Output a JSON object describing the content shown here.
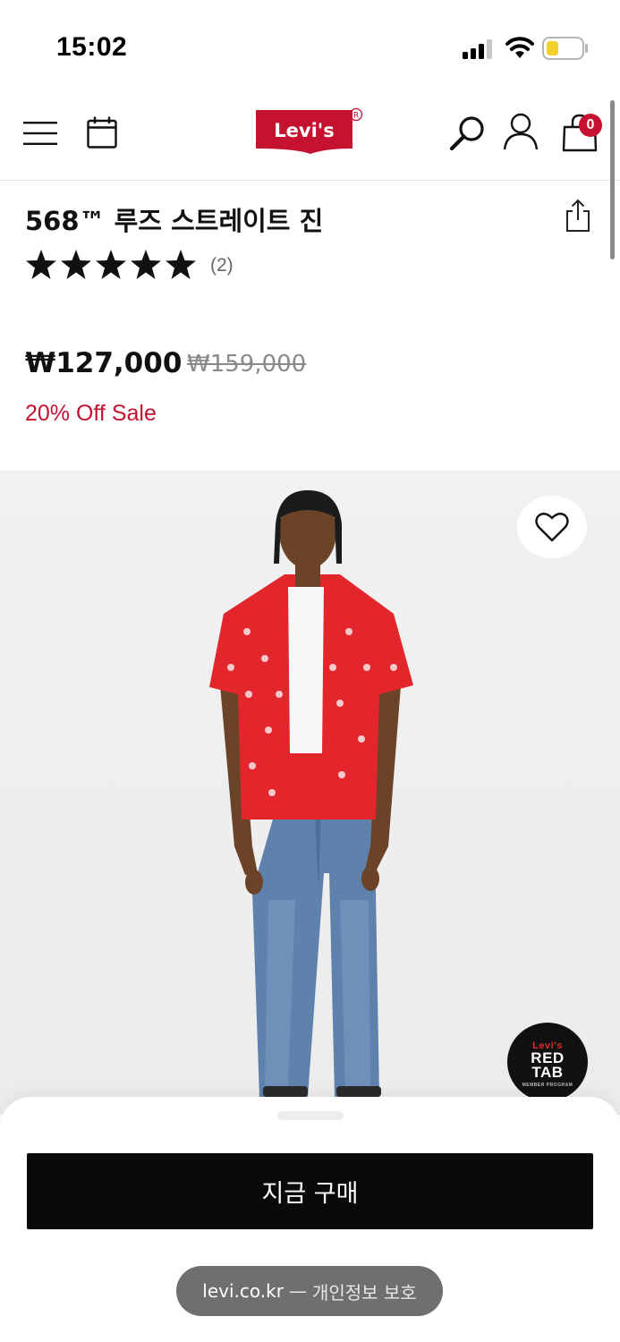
{
  "status_bar": {
    "time": "15:02"
  },
  "header": {
    "logo_text": "Levi's",
    "brand_color": "#c41230",
    "bag_count": "0",
    "icons": [
      "menu-icon",
      "calendar-icon",
      "search-icon",
      "user-icon",
      "bag-icon"
    ]
  },
  "product": {
    "title": "568™ 루즈 스트레이트 진",
    "rating": 5,
    "rating_max": 5,
    "review_count": "(2)",
    "price_current": "₩127,000",
    "price_original": "₩159,000",
    "sale_label": "20% Off Sale",
    "sale_color": "#c41230"
  },
  "badge": {
    "line1": "Levi's",
    "line2": "RED",
    "line3": "TAB",
    "line4": "MEMBER PROGRAM"
  },
  "bottom_sheet": {
    "buy_label": "지금 구매",
    "url_host": "levi.co.kr",
    "url_separator": "—",
    "url_note": "개인정보 보호"
  }
}
